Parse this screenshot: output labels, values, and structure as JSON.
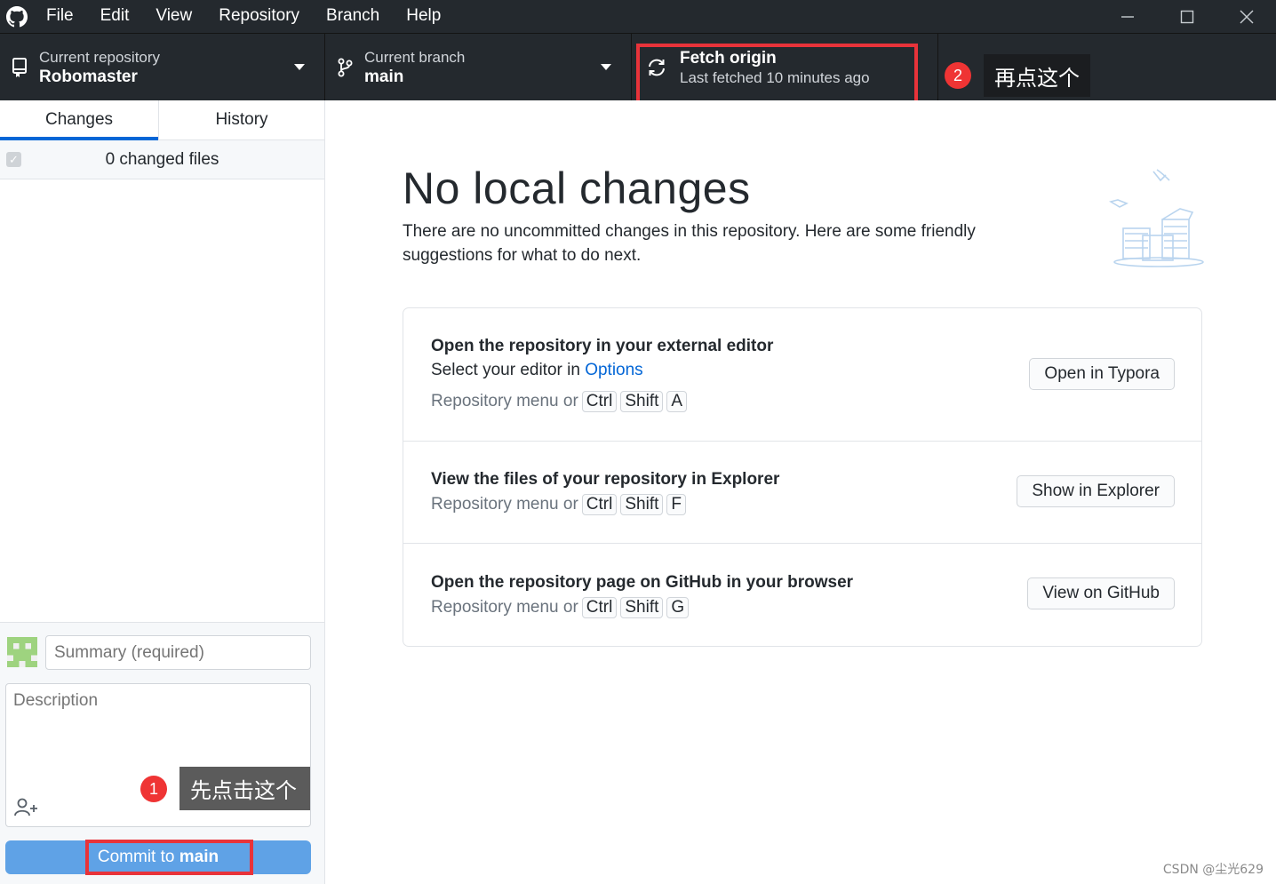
{
  "menu": [
    "File",
    "Edit",
    "View",
    "Repository",
    "Branch",
    "Help"
  ],
  "toolbar": {
    "repo_label": "Current repository",
    "repo_value": "Robomaster",
    "branch_label": "Current branch",
    "branch_value": "main",
    "fetch_title": "Fetch origin",
    "fetch_sub": "Last fetched 10 minutes ago"
  },
  "annotations": {
    "step1_number": "1",
    "step1_text": "先点击这个",
    "step2_number": "2",
    "step2_text": "再点这个",
    "highlight_color": "#e8333a"
  },
  "sidebar": {
    "tabs": [
      "Changes",
      "History"
    ],
    "changed_files": "0 changed files",
    "summary_placeholder": "Summary (required)",
    "description_placeholder": "Description",
    "commit_prefix": "Commit to ",
    "commit_branch": "main"
  },
  "main": {
    "title": "No local changes",
    "subtitle": "There are no uncommitted changes in this repository. Here are some friendly suggestions for what to do next.",
    "suggestions": [
      {
        "title": "Open the repository in your external editor",
        "sub_prefix": "Select your editor in ",
        "sub_link": "Options",
        "shortcut_prefix": "Repository menu or",
        "keys": [
          "Ctrl",
          "Shift",
          "A"
        ],
        "button": "Open in Typora"
      },
      {
        "title": "View the files of your repository in Explorer",
        "shortcut_prefix": "Repository menu or",
        "keys": [
          "Ctrl",
          "Shift",
          "F"
        ],
        "button": "Show in Explorer"
      },
      {
        "title": "Open the repository page on GitHub in your browser",
        "shortcut_prefix": "Repository menu or",
        "keys": [
          "Ctrl",
          "Shift",
          "G"
        ],
        "button": "View on GitHub"
      }
    ]
  },
  "watermark": "CSDN @尘光629",
  "colors": {
    "dark_bar": "#24292e",
    "accent_blue": "#0366d6",
    "commit_button": "#5fa2e6"
  }
}
